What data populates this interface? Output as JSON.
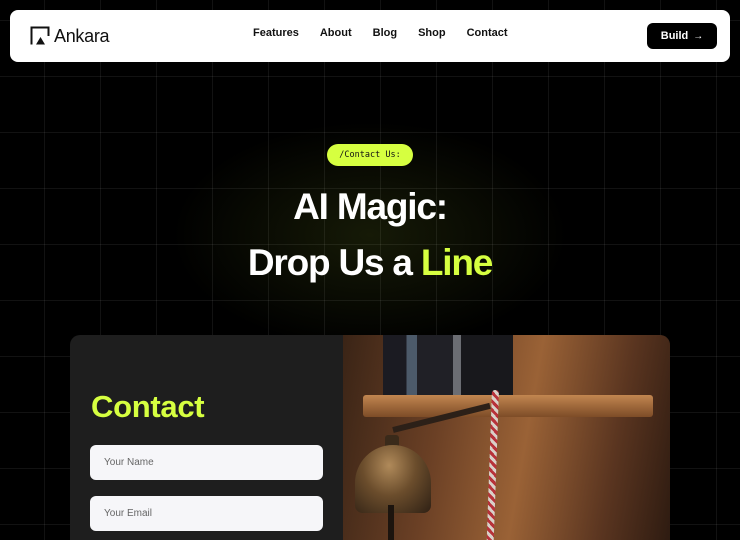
{
  "nav": {
    "brand": "Ankara",
    "links": [
      "Features",
      "About",
      "Blog",
      "Shop",
      "Contact"
    ],
    "cta": "Build",
    "cta_icon": "arrow-right-icon"
  },
  "hero": {
    "tag": "/Contact Us:",
    "line1": "AI Magic:",
    "line2_prefix": "Drop Us a ",
    "line2_accent": "Line"
  },
  "contact": {
    "title": "Contact",
    "name_placeholder": "Your Name",
    "email_placeholder": "Your Email"
  },
  "colors": {
    "accent": "#d6ff40",
    "background": "#000000",
    "card": "#1e1e1e",
    "navbar": "#ffffff"
  }
}
